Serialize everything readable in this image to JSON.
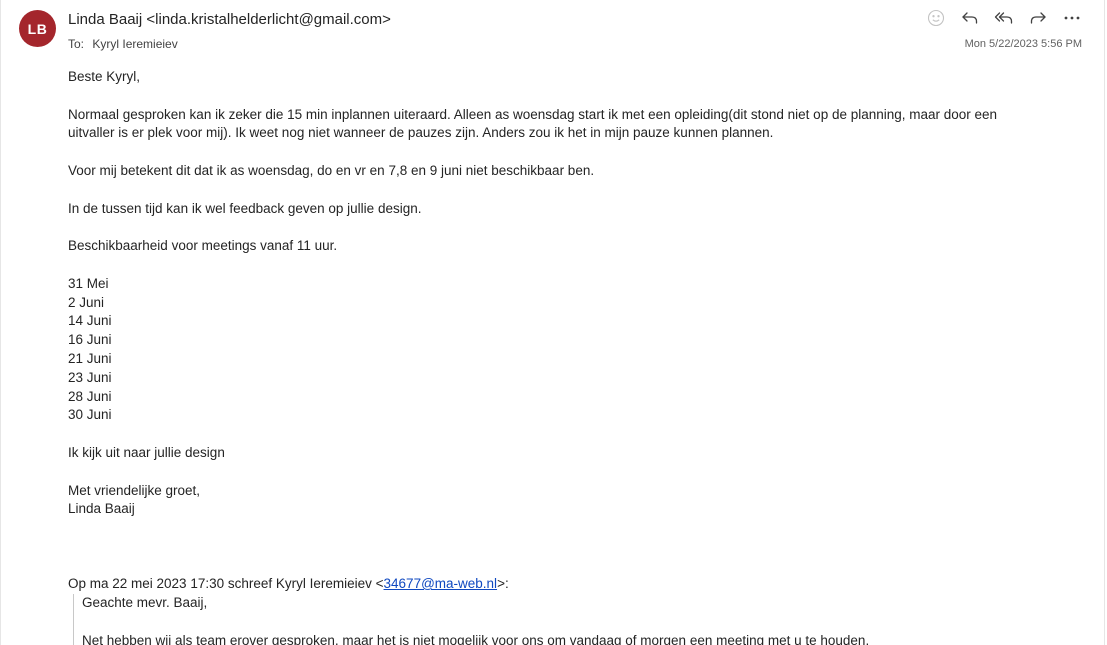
{
  "sender": {
    "initials": "LB",
    "avatar_color": "#a4262c",
    "name": "Linda Baaij",
    "email": "<linda.kristalhelderlicht@gmail.com>"
  },
  "recipients": {
    "label": "To:",
    "to": "Kyryl Ieremieiev"
  },
  "date": "Mon 5/22/2023 5:56 PM",
  "actions": [
    {
      "icon": "smiley-icon"
    },
    {
      "icon": "reply-icon"
    },
    {
      "icon": "reply-all-icon"
    },
    {
      "icon": "forward-icon"
    },
    {
      "icon": "more-icon"
    }
  ],
  "body": {
    "greeting": "Beste Kyryl,",
    "p1_line1": "Normaal gesproken kan ik zeker die 15 min inplannen uiteraard. Alleen as woensdag start ik met een opleiding(dit stond niet op de planning, maar door een",
    "p1_line2": "uitvaller is er plek voor mij). Ik weet nog niet wanneer de pauzes zijn. Anders zou ik het in mijn pauze kunnen plannen.",
    "p2": "Voor mij betekent dit dat ik as woensdag, do en vr en 7,8 en 9 juni niet beschikbaar ben.",
    "p3": "In de tussen tijd kan ik wel feedback geven op jullie design.",
    "p4": "Beschikbaarheid voor meetings vanaf 11 uur.",
    "dates": [
      "31 Mei",
      "2 Juni",
      "14 Juni",
      "16 Juni",
      "21 Juni",
      "23 Juni",
      "28 Juni",
      "30 Juni"
    ],
    "closing_line": "Ik kijk uit naar jullie design",
    "signoff": "Met vriendelijke groet,",
    "signature": "Linda Baaij"
  },
  "quote": {
    "header_prefix": "Op ma 22 mei 2023 17:30 schreef Kyryl Ieremieiev <",
    "header_link": "34677@ma-web.nl",
    "header_suffix": ">:",
    "greeting": "Geachte mevr. Baaij,",
    "line1": "Net hebben wij als team erover gesproken, maar het is niet mogelijk voor ons om vandaag of morgen een meeting met u te houden."
  }
}
